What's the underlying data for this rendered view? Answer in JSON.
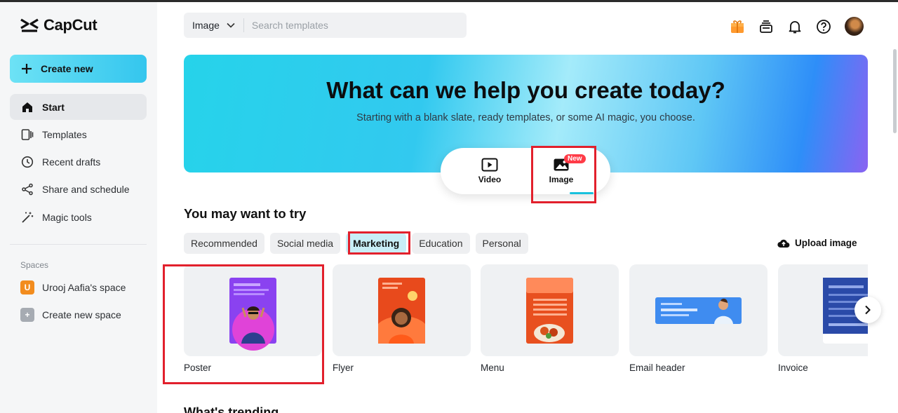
{
  "app": {
    "name": "CapCut"
  },
  "sidebar": {
    "create_label": "Create new",
    "items": [
      {
        "label": "Start",
        "icon": "home-icon",
        "active": true
      },
      {
        "label": "Templates",
        "icon": "templates-icon"
      },
      {
        "label": "Recent drafts",
        "icon": "clock-icon"
      },
      {
        "label": "Share and schedule",
        "icon": "share-icon"
      },
      {
        "label": "Magic tools",
        "icon": "magic-wand-icon"
      }
    ],
    "spaces_title": "Spaces",
    "spaces": [
      {
        "badge": "U",
        "label": "Urooj Aafia's space",
        "color": "#f28c1e"
      },
      {
        "badge": "+",
        "label": "Create new space",
        "color": "#a6abb2"
      }
    ]
  },
  "search": {
    "type_value": "Image",
    "placeholder": "Search templates"
  },
  "hero": {
    "title": "What can we help you create today?",
    "subtitle": "Starting with a blank slate, ready templates, or some AI magic, you choose.",
    "modes": [
      {
        "label": "Video"
      },
      {
        "label": "Image",
        "badge": "New",
        "selected": true
      }
    ]
  },
  "section": {
    "title": "You may want to try",
    "chips": [
      "Recommended",
      "Social media",
      "Marketing",
      "Education",
      "Personal"
    ],
    "active_chip": "Marketing",
    "upload_label": "Upload image",
    "cards": [
      {
        "label": "Poster"
      },
      {
        "label": "Flyer"
      },
      {
        "label": "Menu"
      },
      {
        "label": "Email header"
      },
      {
        "label": "Invoice"
      }
    ],
    "next_section_peek": "What's trending"
  },
  "colors": {
    "accent": "#18c1dd",
    "highlight": "#e2202c",
    "active_chip": "#c8eef7"
  }
}
